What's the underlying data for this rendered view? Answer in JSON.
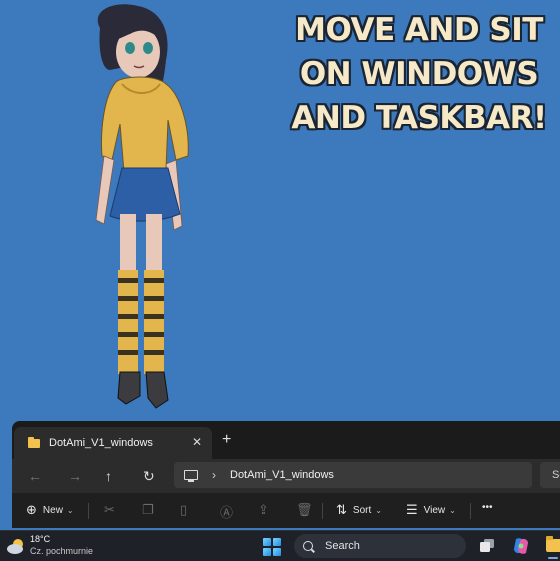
{
  "headline": {
    "lines": [
      "MOVE AND SIT",
      "ON WINDOWS",
      "AND TASKBAR!"
    ]
  },
  "explorer": {
    "tab_title": "DotAmi_V1_windows",
    "tab_close": "✕",
    "new_tab": "+",
    "nav": {
      "back": "←",
      "forward": "→",
      "up": "↑",
      "refresh": "↻"
    },
    "breadcrumb_sep": "›",
    "breadcrumb": "DotAmi_V1_windows",
    "search_placeholder": "Se",
    "toolbar": {
      "new_label": "New",
      "sort_label": "Sort",
      "view_label": "View",
      "more": "•••"
    }
  },
  "taskbar": {
    "temperature": "18°C",
    "condition": "Cz. pochmurnie",
    "search_placeholder": "Search"
  },
  "colors": {
    "desktop": "#3d79bd",
    "headline_fill": "#f5e9c8",
    "folder": "#f2c14e",
    "explorer_bg": "#1f1f1f",
    "taskbar_bg": "#1e2228"
  }
}
